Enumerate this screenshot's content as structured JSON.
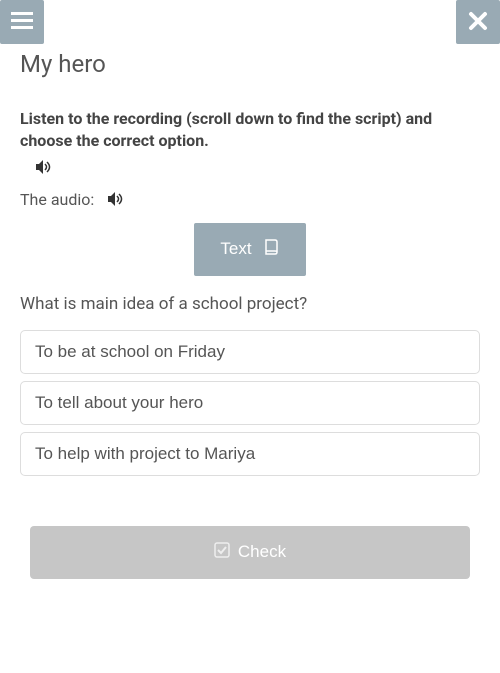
{
  "title": "My hero",
  "instruction": "Listen to the recording (scroll down to find the script) and choose the correct option.",
  "audio_label": "The audio:",
  "text_button": "Text",
  "question": "What is main idea of a school project?",
  "options": [
    "To be at school on Friday",
    "To tell about your hero",
    "To help with project to Mariya"
  ],
  "check_button": "Check"
}
